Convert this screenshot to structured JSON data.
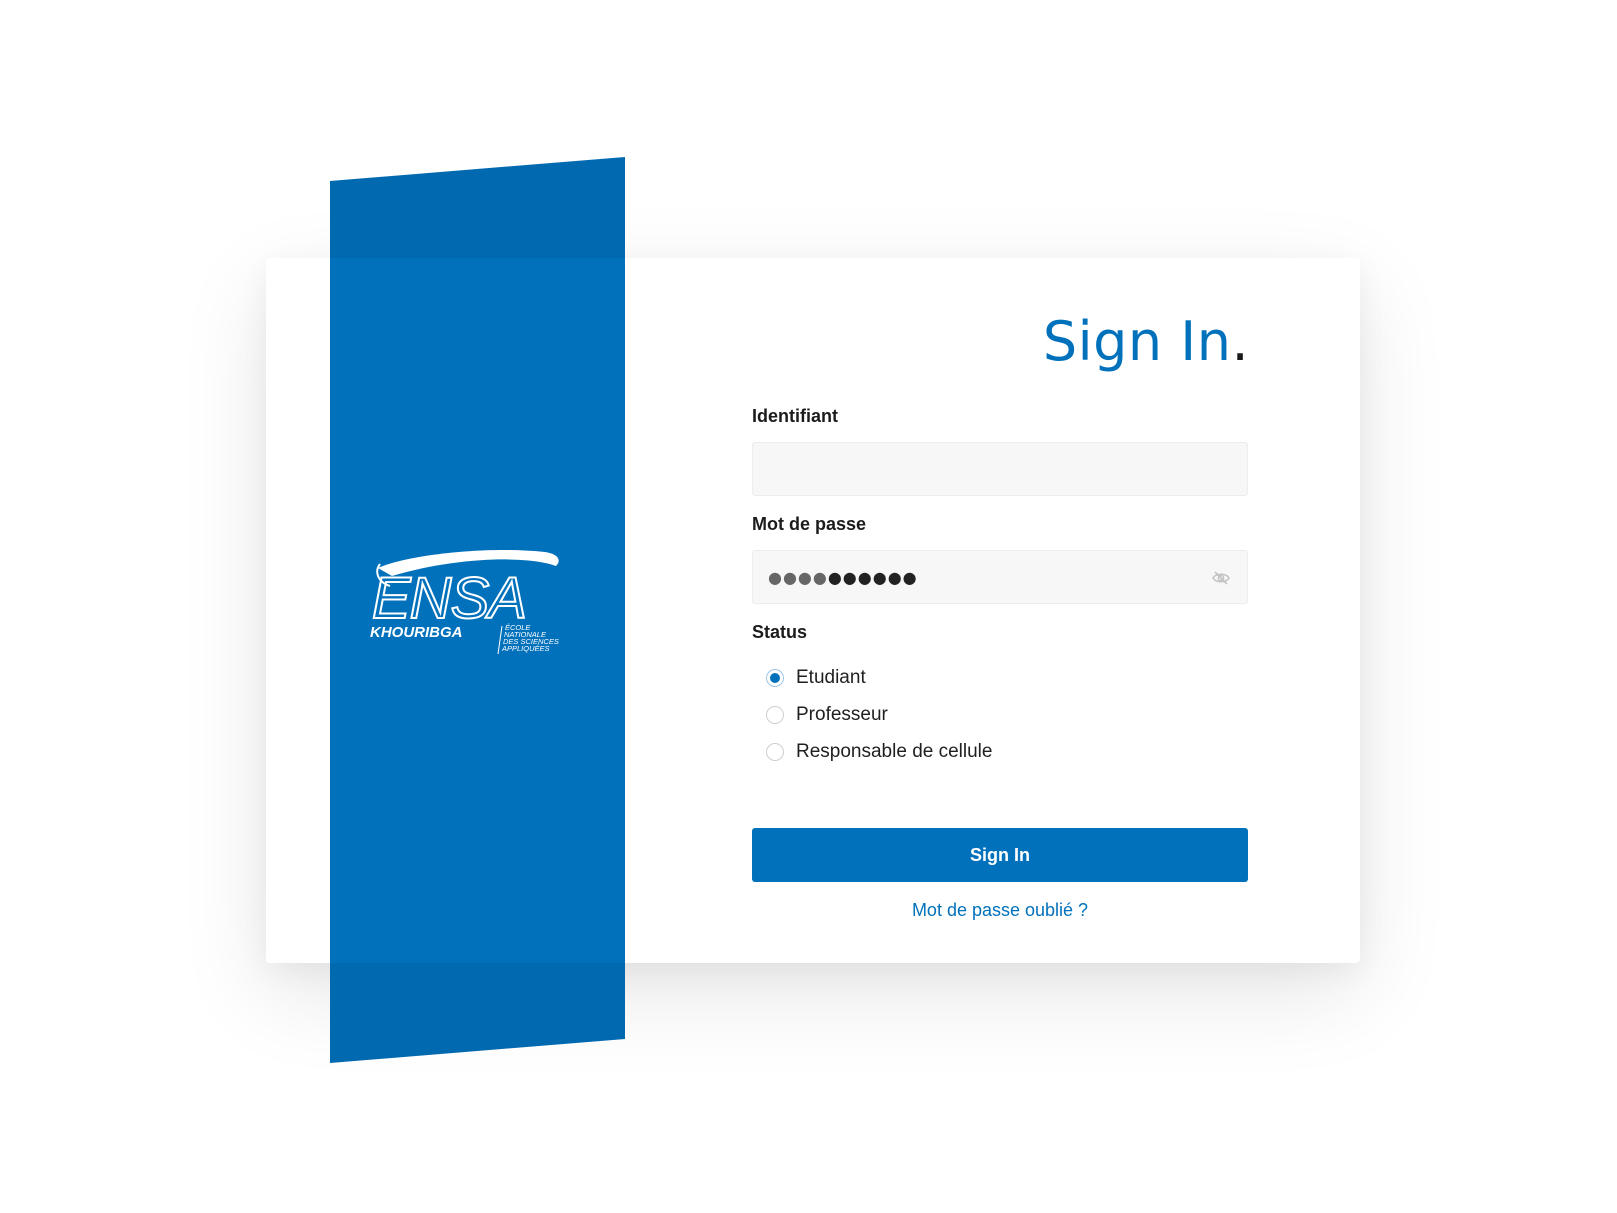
{
  "colors": {
    "brand_blue": "#0271bb",
    "page_background": "#ffffff",
    "field_background": "#f7f7f7"
  },
  "logo": {
    "name": "ENSA",
    "city": "KHOURIBGA",
    "tagline": [
      "ÉCOLE",
      "NATIONALE",
      "DES SCIENCES",
      "APPLIQUÉES"
    ]
  },
  "form": {
    "title": "Sign In",
    "title_dot": ".",
    "username": {
      "label": "Identifiant",
      "value": "",
      "placeholder": ""
    },
    "password": {
      "label": "Mot de passe",
      "masked_value": "●●●●●●●●●●",
      "visibility_icon": "eye-off-icon"
    },
    "status": {
      "label": "Status",
      "options": [
        {
          "label": "Etudiant",
          "checked": true
        },
        {
          "label": "Professeur",
          "checked": false
        },
        {
          "label": "Responsable de cellule",
          "checked": false
        }
      ]
    },
    "submit_label": "Sign In",
    "forgot_label": "Mot de passe oublié ?"
  }
}
